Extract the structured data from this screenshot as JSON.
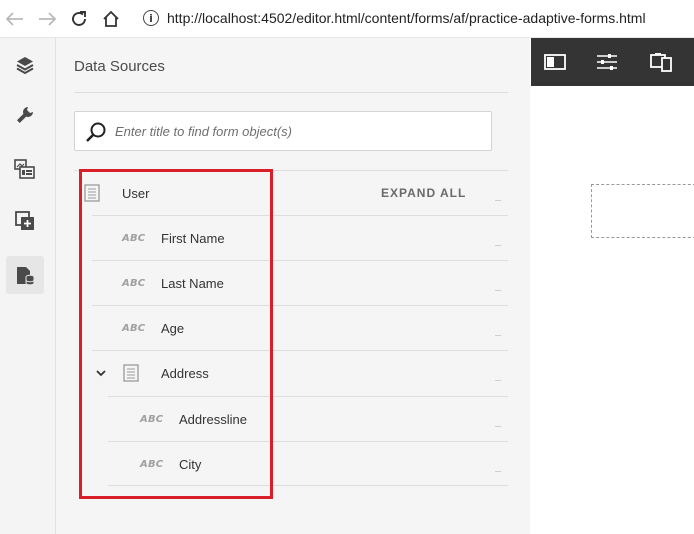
{
  "browser": {
    "url": "http://localhost:4502/editor.html/content/forms/af/practice-adaptive-forms.html"
  },
  "rail": {
    "items": [
      {
        "icon": "layers-icon"
      },
      {
        "icon": "wrench-icon"
      },
      {
        "icon": "assets-icon"
      },
      {
        "icon": "components-icon"
      },
      {
        "icon": "data-sources-icon",
        "active": true
      }
    ]
  },
  "panel": {
    "title": "Data Sources",
    "search_placeholder": "Enter title to find form object(s)",
    "expand_all": "EXPAND ALL",
    "tree": [
      {
        "label": "User",
        "type": "object"
      },
      {
        "label": "First Name",
        "type": "text",
        "badge": "ABC"
      },
      {
        "label": "Last Name",
        "type": "text",
        "badge": "ABC"
      },
      {
        "label": "Age",
        "type": "text",
        "badge": "ABC"
      },
      {
        "label": "Address",
        "type": "object",
        "expanded": true
      },
      {
        "label": "Addressline",
        "type": "text",
        "badge": "ABC"
      },
      {
        "label": "City",
        "type": "text",
        "badge": "ABC"
      }
    ]
  },
  "colors": {
    "highlight": "#d9202a",
    "toolbar": "#343434"
  }
}
